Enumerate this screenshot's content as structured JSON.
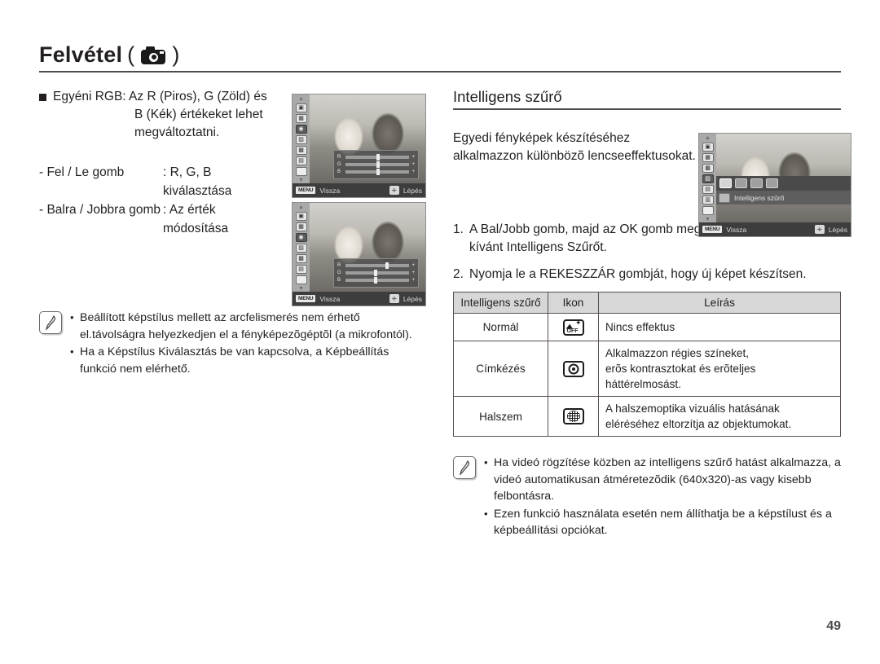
{
  "header": {
    "title": "Felvétel",
    "open_paren": "(",
    "close_paren": ")",
    "icon": "camera-icon"
  },
  "left_column": {
    "rgb_bullet": {
      "lead": "Egyéni RGB: Az R (Piros), G (Zöld) és",
      "line2": "B (Kék) értékeket lehet",
      "line3": "megváltoztatni."
    },
    "controls": [
      {
        "key": "- Fel / Le gomb",
        "value": ": R, G, B",
        "cont": "kiválasztása"
      },
      {
        "key": "- Balra / Jobbra gomb",
        "value": ": Az érték",
        "cont": "módosítása"
      }
    ],
    "note": {
      "icon": "note-pencil-icon",
      "items": [
        "Beállított képstílus mellett az arcfelismerés nem érhető el.távolságra helyezkedjen el a fényképezõgéptõl (a mikrofontól).",
        "Ha a Képstílus Kiválasztás be van kapcsolva, a Képbeállítás funkció nem elérhető."
      ]
    }
  },
  "right_column": {
    "section_title": "Intelligens szűrő",
    "intro": "Egyedi fényképek készítéséhez alkalmazzon különbözõ lencseeffektusokat.",
    "steps": [
      {
        "num": "1.",
        "text": "A Bal/Jobb gomb, majd az OK gomb megnyomásával állítsa be a kívánt Intelligens Szűrőt."
      },
      {
        "num": "2.",
        "text": "Nyomja le a REKESZZÁR gombját, hogy új képet készítsen."
      }
    ],
    "table": {
      "headers": [
        "Intelligens szűrő",
        "Ikon",
        "Leírás"
      ],
      "rows": [
        {
          "name": "Normál",
          "icon": "filter-off-icon",
          "desc_lines": [
            "Nincs effektus"
          ]
        },
        {
          "name": "Címkézés",
          "icon": "vignette-icon",
          "desc_lines": [
            "Alkalmazzon régies színeket,",
            "erõs kontrasztokat és erõteljes háttérelmosást."
          ]
        },
        {
          "name": "Halszem",
          "icon": "fisheye-icon",
          "desc_lines": [
            "A halszemoptika vizuális hatásának",
            "eléréséhez eltorzítja az objektumokat."
          ]
        }
      ]
    },
    "note": {
      "icon": "note-pencil-icon",
      "items": [
        "Ha videó rögzítése közben az intelligens szűrő hatást alkalmazza, a videó automatikusan átméretezõdik (640x320)-as vagy kisebb felbontásra.",
        "Ezen funkció használata esetén nem állíthatja be a képstílust és a képbeállítási opciókat."
      ]
    }
  },
  "lcd_screens": {
    "rgb_screen_1": {
      "back_chip": "MENU",
      "back_label": "Vissza",
      "ok_label": "Lépés",
      "sliders": [
        {
          "label": "R",
          "plus": "+"
        },
        {
          "label": "G",
          "plus": "+"
        },
        {
          "label": "B",
          "plus": "+"
        }
      ]
    },
    "rgb_screen_2": {
      "back_chip": "MENU",
      "back_label": "Vissza",
      "ok_label": "Lépés",
      "sliders": [
        {
          "label": "R",
          "plus": "+"
        },
        {
          "label": "G",
          "plus": "+"
        },
        {
          "label": "B",
          "plus": "+"
        }
      ]
    },
    "filter_screen": {
      "menu_label": "Intelligens szűrő",
      "back_chip": "MENU",
      "back_label": "Vissza",
      "ok_label": "Lépés"
    }
  },
  "footer": {
    "page_number": "49"
  },
  "colors": {
    "text": "#231f20",
    "rule": "#4d4d4d",
    "table_header_bg": "#d7d7d7",
    "table_border": "#58504e"
  }
}
